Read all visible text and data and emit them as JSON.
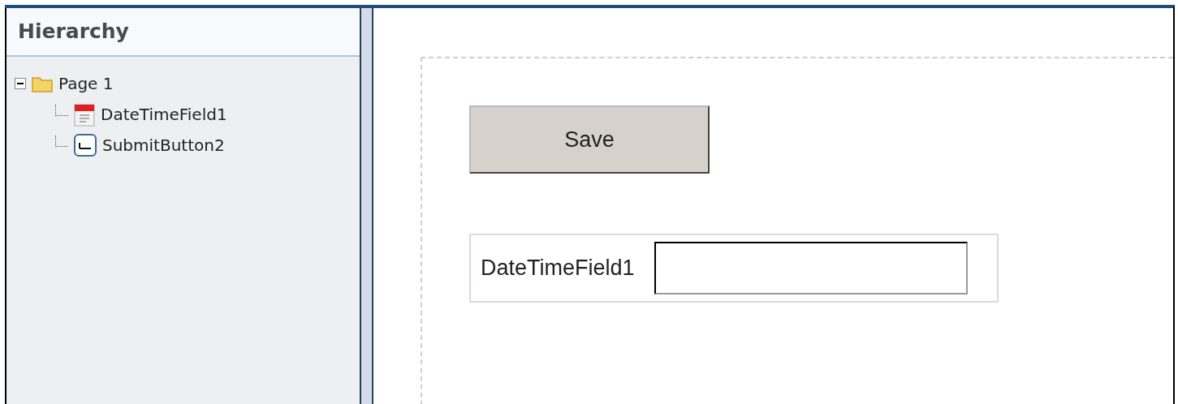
{
  "hierarchy": {
    "title": "Hierarchy",
    "tree": [
      {
        "label": "Page 1",
        "kind": "folder",
        "expanded": true,
        "children": [
          {
            "label": "DateTimeField1",
            "kind": "calendar"
          },
          {
            "label": "SubmitButton2",
            "kind": "textbutton"
          }
        ]
      }
    ]
  },
  "canvas": {
    "button": {
      "label": "Save"
    },
    "field": {
      "label": "DateTimeField1"
    }
  }
}
